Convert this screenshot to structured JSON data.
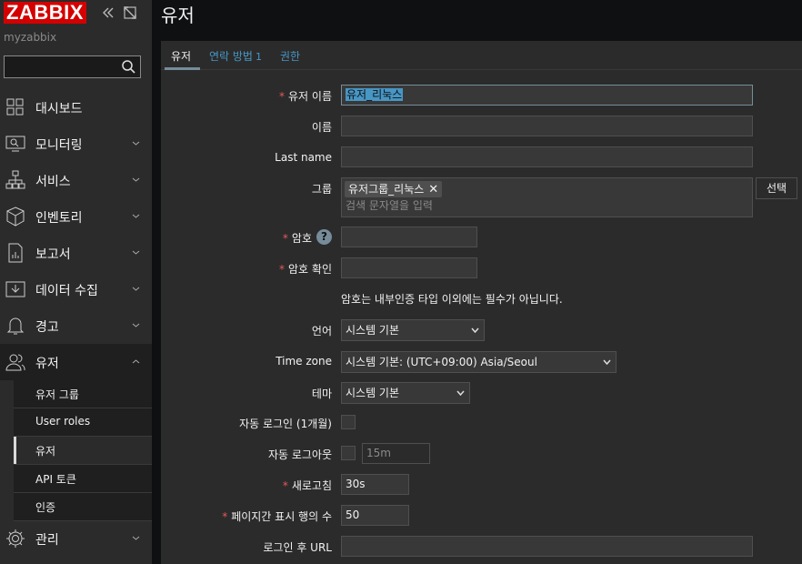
{
  "sidebar": {
    "logo": "ZABBIX",
    "server_name": "myzabbix",
    "search_placeholder": "",
    "nav": [
      {
        "label": "대시보드",
        "icon": "dashboard-icon"
      },
      {
        "label": "모니터링",
        "icon": "monitoring-icon"
      },
      {
        "label": "서비스",
        "icon": "services-icon"
      },
      {
        "label": "인벤토리",
        "icon": "inventory-icon"
      },
      {
        "label": "보고서",
        "icon": "reports-icon"
      },
      {
        "label": "데이터 수집",
        "icon": "data-collection-icon"
      },
      {
        "label": "경고",
        "icon": "alerts-icon"
      },
      {
        "label": "유저",
        "icon": "users-icon"
      },
      {
        "label": "관리",
        "icon": "administration-icon"
      }
    ],
    "users_sub": [
      {
        "label": "유저 그룹"
      },
      {
        "label": "User roles"
      },
      {
        "label": "유저"
      },
      {
        "label": "API 토큰"
      },
      {
        "label": "인증"
      }
    ]
  },
  "page": {
    "title": "유저",
    "tabs": [
      {
        "label": "유저"
      },
      {
        "label": "연락 방법",
        "count": "1"
      },
      {
        "label": "권한"
      }
    ]
  },
  "form": {
    "username_label": "유저 이름",
    "username_value": "유저_리눅스",
    "name_label": "이름",
    "name_value": "",
    "lastname_label": "Last name",
    "lastname_value": "",
    "groups_label": "그룹",
    "group_chip": "유저그룹_리눅스",
    "groups_placeholder": "검색 문자열을 입력",
    "select_button": "선택",
    "password_label": "암호",
    "password_help": "?",
    "password_confirm_label": "암호 확인",
    "password_hint": "암호는 내부인증 타입 이외에는 필수가 아닙니다.",
    "language_label": "언어",
    "language_value": "시스템 기본",
    "timezone_label": "Time zone",
    "timezone_value": "시스템 기본: (UTC+09:00) Asia/Seoul",
    "theme_label": "테마",
    "theme_value": "시스템 기본",
    "autologin_label": "자동 로그인 (1개월)",
    "autologout_label": "자동 로그아웃",
    "autologout_value": "15m",
    "refresh_label": "새로고침",
    "refresh_value": "30s",
    "rows_label": "페이지간 표시 행의 수",
    "rows_value": "50",
    "url_label": "로그인 후 URL",
    "url_value": ""
  },
  "colors": {
    "brand": "#d40000",
    "accent": "#4796c4",
    "required": "#e45959"
  }
}
